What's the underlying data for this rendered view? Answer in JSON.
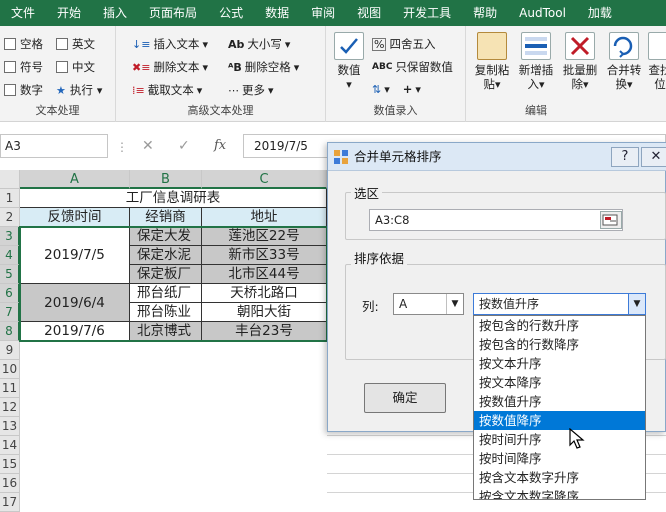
{
  "ribbon": {
    "tabs": [
      "文件",
      "开始",
      "插入",
      "页面布局",
      "公式",
      "数据",
      "审阅",
      "视图",
      "开发工具",
      "帮助",
      "AudTool",
      "加载"
    ],
    "text_group": {
      "label": "文本处理",
      "checks": [
        "空格",
        "英文",
        "符号",
        "中文",
        "数字"
      ],
      "execute": "执行"
    },
    "adv_group": {
      "label": "高级文本处理",
      "insert_text": "插入文本",
      "delete_text": "删除文本",
      "extract_text": "截取文本",
      "case": "大小写",
      "delete_space": "删除空格",
      "more": "更多"
    },
    "num_group": {
      "label": "数值录入",
      "numeric": "数值",
      "round": "四舍五入",
      "keep_numeric": "只保留数值",
      "plus": "+"
    },
    "edit_group": {
      "label": "编辑",
      "copy_paste_1": "复制粘",
      "copy_paste_2": "贴",
      "add_insert_1": "新增插",
      "add_insert_2": "入",
      "batch_delete_1": "批量删",
      "batch_delete_2": "除",
      "merge_convert_1": "合并转",
      "merge_convert_2": "换",
      "find_1": "查找",
      "find_2": "位"
    }
  },
  "formula_bar": {
    "name_box": "A3",
    "cancel": "✕",
    "enter": "✓",
    "fx": "fx",
    "value": "2019/7/5"
  },
  "sheet": {
    "columns": [
      "A",
      "B",
      "C"
    ],
    "rows": [
      "1",
      "2",
      "3",
      "4",
      "5",
      "6",
      "7",
      "8",
      "9",
      "10",
      "11",
      "12",
      "13",
      "14",
      "15",
      "16",
      "17"
    ],
    "title": "工厂信息调研表",
    "headers": [
      "反馈时间",
      "经销商",
      "地址"
    ],
    "dates": [
      "2019/7/5",
      "2019/6/4",
      "2019/7/6"
    ],
    "dealers": [
      "保定大发",
      "保定水泥",
      "保定板厂",
      "邢台纸厂",
      "邢台陈业",
      "北京博式"
    ],
    "addresses": [
      "莲池区22号",
      "新市区33号",
      "北市区44号",
      "天桥北路口",
      "朝阳大街",
      "丰台23号"
    ]
  },
  "dialog": {
    "title": "合并单元格排序",
    "help": "?",
    "close": "✕",
    "range_label": "选区",
    "range_value": "A3:C8",
    "sort_label": "排序依据",
    "column_label": "列:",
    "column_value": "A",
    "method_value": "按数值升序",
    "ok": "确定",
    "options": [
      "按包含的行数升序",
      "按包含的行数降序",
      "按文本升序",
      "按文本降序",
      "按数值升序",
      "按数值降序",
      "按时间升序",
      "按时间降序",
      "按含文本数字升序",
      "按含文本数字降序"
    ],
    "selected_option": "按数值降序"
  }
}
